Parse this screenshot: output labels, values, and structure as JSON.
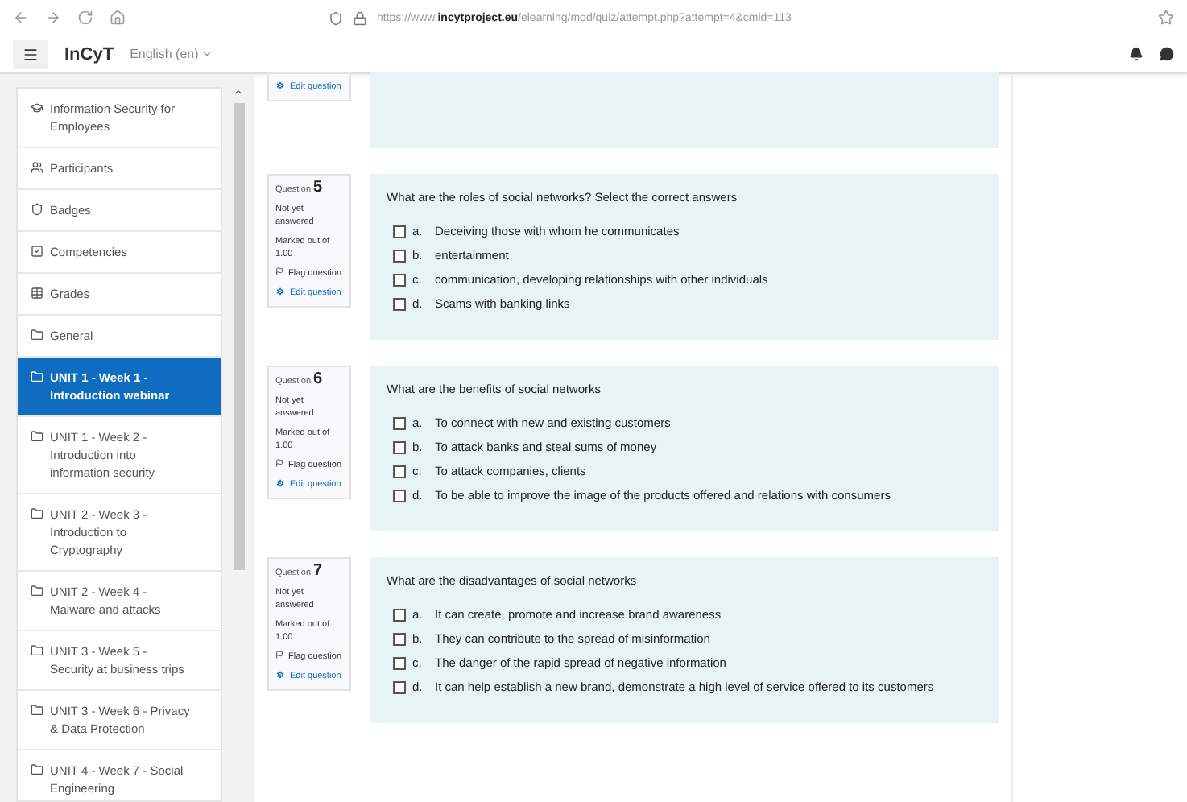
{
  "browser": {
    "url": "https://www.**incytproject.eu**/elearning/mod/quiz/attempt.php?attempt=4&cmid=113"
  },
  "navbar": {
    "brand": "InCyT",
    "language": "English (en)"
  },
  "sidebar": {
    "items": [
      {
        "label": "Information Security for Employees",
        "kind": "course",
        "selected": false
      },
      {
        "label": "Participants",
        "kind": "participants",
        "selected": false
      },
      {
        "label": "Badges",
        "kind": "badges",
        "selected": false
      },
      {
        "label": "Competencies",
        "kind": "competencies",
        "selected": false
      },
      {
        "label": "Grades",
        "kind": "grades",
        "selected": false
      },
      {
        "label": "General",
        "kind": "section",
        "selected": false
      },
      {
        "label": "UNIT 1 - Week 1 - Introduction webinar",
        "kind": "section",
        "selected": true
      },
      {
        "label": "UNIT 1 - Week 2 - Introduction into information security",
        "kind": "section",
        "selected": false
      },
      {
        "label": "UNIT 2 - Week 3 - Introduction to Cryptography",
        "kind": "section",
        "selected": false
      },
      {
        "label": "UNIT 2 - Week 4 - Malware and attacks",
        "kind": "section",
        "selected": false
      },
      {
        "label": "UNIT 3 - Week 5 - Security at business trips",
        "kind": "section",
        "selected": false
      },
      {
        "label": "UNIT 3 - Week 6 - Privacy & Data Protection",
        "kind": "section",
        "selected": false
      },
      {
        "label": "UNIT 4 - Week 7 - Social Engineering",
        "kind": "section",
        "selected": false
      }
    ]
  },
  "previous_question": {
    "edit": "Edit question"
  },
  "questions": [
    {
      "label": "Question",
      "number": "5",
      "status": "Not yet answered",
      "marks": "Marked out of 1.00",
      "flag": "Flag question",
      "edit": "Edit question",
      "text": "What are the roles of social networks? Select the correct answers",
      "options": [
        {
          "letter": "a.",
          "text": "Deceiving those with whom he communicates",
          "checked": false
        },
        {
          "letter": "b.",
          "text": "entertainment",
          "checked": false
        },
        {
          "letter": "c.",
          "text": "communication, developing relationships with other individuals",
          "checked": false
        },
        {
          "letter": "d.",
          "text": "Scams with banking links",
          "checked": false
        }
      ]
    },
    {
      "label": "Question",
      "number": "6",
      "status": "Not yet answered",
      "marks": "Marked out of 1.00",
      "flag": "Flag question",
      "edit": "Edit question",
      "text": "What are the benefits of social networks",
      "options": [
        {
          "letter": "a.",
          "text": "To connect with new and existing customers",
          "checked": false
        },
        {
          "letter": "b.",
          "text": "To attack banks and steal sums of money",
          "checked": false
        },
        {
          "letter": "c.",
          "text": "To attack companies, clients",
          "checked": false
        },
        {
          "letter": "d.",
          "text": "To be able to improve the image of the products offered and relations with consumers",
          "checked": false
        }
      ]
    },
    {
      "label": "Question",
      "number": "7",
      "status": "Not yet answered",
      "marks": "Marked out of 1.00",
      "flag": "Flag question",
      "edit": "Edit question",
      "text": "What are the disadvantages of social networks",
      "options": [
        {
          "letter": "a.",
          "text": "It can create, promote and increase brand awareness",
          "checked": false
        },
        {
          "letter": "b.",
          "text": "They can contribute to the spread of misinformation",
          "checked": false
        },
        {
          "letter": "c.",
          "text": "The danger of the rapid spread of negative information",
          "checked": false
        },
        {
          "letter": "d.",
          "text": "It can help establish a new brand, demonstrate a high level of service offered to its customers",
          "checked": false
        }
      ]
    }
  ]
}
